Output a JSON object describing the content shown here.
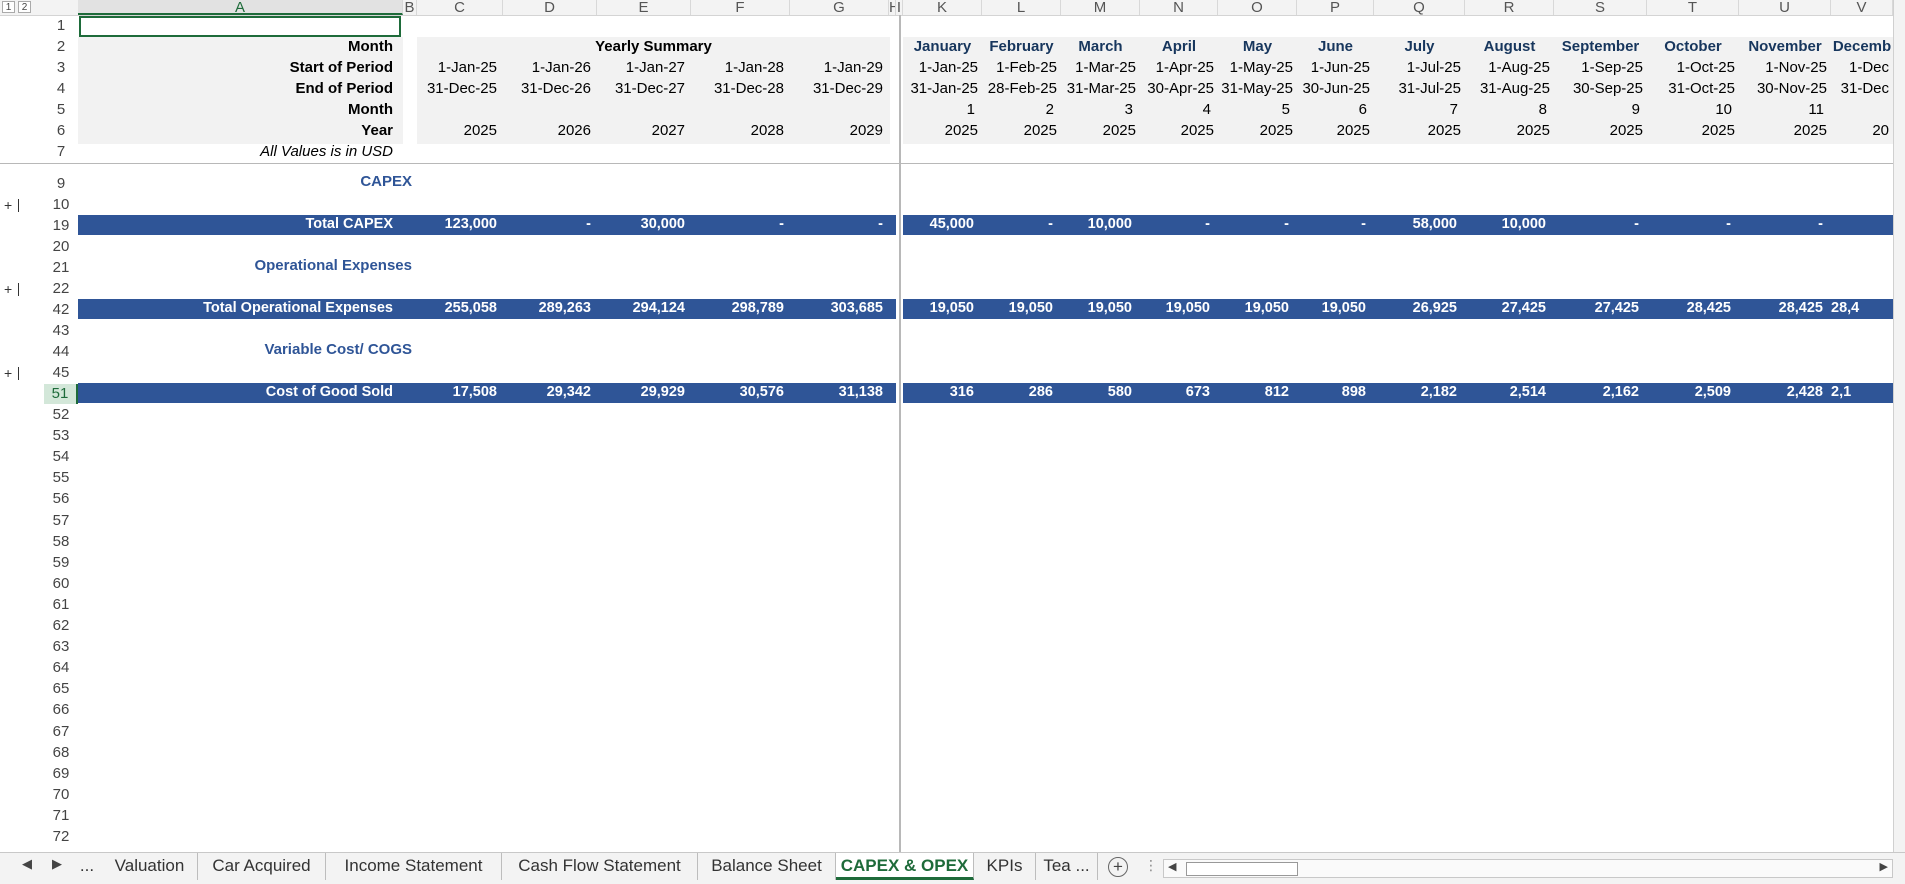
{
  "outline_levels": [
    "1",
    "2"
  ],
  "columns": [
    "A",
    "B",
    "C",
    "D",
    "E",
    "F",
    "G",
    "H",
    "I",
    "K",
    "L",
    "M",
    "N",
    "O",
    "P",
    "Q",
    "R",
    "S",
    "T",
    "U",
    "V"
  ],
  "header_rows": {
    "labels": [
      "Month",
      "Start of Period",
      "End of Period",
      "Month",
      "Year",
      "All Values is in USD"
    ],
    "yearly_summary_title": "Yearly Summary",
    "yearly": [
      {
        "start": "1-Jan-25",
        "end": "31-Dec-25",
        "year": "2025"
      },
      {
        "start": "1-Jan-26",
        "end": "31-Dec-26",
        "year": "2026"
      },
      {
        "start": "1-Jan-27",
        "end": "31-Dec-27",
        "year": "2027"
      },
      {
        "start": "1-Jan-28",
        "end": "31-Dec-28",
        "year": "2028"
      },
      {
        "start": "1-Jan-29",
        "end": "31-Dec-29",
        "year": "2029"
      }
    ],
    "monthly": [
      {
        "name": "January",
        "start": "1-Jan-25",
        "end": "31-Jan-25",
        "num": "1",
        "year": "2025"
      },
      {
        "name": "February",
        "start": "1-Feb-25",
        "end": "28-Feb-25",
        "num": "2",
        "year": "2025"
      },
      {
        "name": "March",
        "start": "1-Mar-25",
        "end": "31-Mar-25",
        "num": "3",
        "year": "2025"
      },
      {
        "name": "April",
        "start": "1-Apr-25",
        "end": "30-Apr-25",
        "num": "4",
        "year": "2025"
      },
      {
        "name": "May",
        "start": "1-May-25",
        "end": "31-May-25",
        "num": "5",
        "year": "2025"
      },
      {
        "name": "June",
        "start": "1-Jun-25",
        "end": "30-Jun-25",
        "num": "6",
        "year": "2025"
      },
      {
        "name": "July",
        "start": "1-Jul-25",
        "end": "31-Jul-25",
        "num": "7",
        "year": "2025"
      },
      {
        "name": "August",
        "start": "1-Aug-25",
        "end": "31-Aug-25",
        "num": "8",
        "year": "2025"
      },
      {
        "name": "September",
        "start": "1-Sep-25",
        "end": "30-Sep-25",
        "num": "9",
        "year": "2025"
      },
      {
        "name": "October",
        "start": "1-Oct-25",
        "end": "31-Oct-25",
        "num": "10",
        "year": "2025"
      },
      {
        "name": "November",
        "start": "1-Nov-25",
        "end": "30-Nov-25",
        "num": "11",
        "year": "2025"
      },
      {
        "name": "Decemb",
        "start": "1-Dec",
        "end": "31-Dec",
        "num": "",
        "year": "20"
      }
    ]
  },
  "sections": {
    "capex_title": "CAPEX",
    "opex_title": "Operational Expenses",
    "cogs_title": "Variable Cost/ COGS"
  },
  "totals": [
    {
      "label": "Total CAPEX",
      "yearly": [
        "123,000",
        "-",
        "30,000",
        "-",
        "-"
      ],
      "monthly": [
        "45,000",
        "-",
        "10,000",
        "-",
        "-",
        "-",
        "58,000",
        "10,000",
        "-",
        "-",
        "-",
        ""
      ]
    },
    {
      "label": "Total Operational Expenses",
      "yearly": [
        "255,058",
        "289,263",
        "294,124",
        "298,789",
        "303,685"
      ],
      "monthly": [
        "19,050",
        "19,050",
        "19,050",
        "19,050",
        "19,050",
        "19,050",
        "26,925",
        "27,425",
        "27,425",
        "28,425",
        "28,425",
        "28,4"
      ]
    },
    {
      "label": "Cost of Good Sold",
      "yearly": [
        "17,508",
        "29,342",
        "29,929",
        "30,576",
        "31,138"
      ],
      "monthly": [
        "316",
        "286",
        "580",
        "673",
        "812",
        "898",
        "2,182",
        "2,514",
        "2,162",
        "2,509",
        "2,428",
        "2,1"
      ]
    }
  ],
  "row_numbers": [
    "1",
    "2",
    "3",
    "4",
    "5",
    "6",
    "7",
    "9",
    "10",
    "19",
    "20",
    "21",
    "22",
    "42",
    "43",
    "44",
    "45",
    "51",
    "52",
    "53",
    "54",
    "55",
    "56",
    "57",
    "58",
    "59",
    "60",
    "61",
    "62",
    "63",
    "64",
    "65",
    "66",
    "67",
    "68",
    "69",
    "70",
    "71",
    "72"
  ],
  "selected_row": "51",
  "tabs": [
    "...",
    "Valuation",
    "Car Acquired",
    "Income Statement",
    "Cash Flow Statement",
    "Balance Sheet",
    "CAPEX & OPEX",
    "KPIs",
    "Tea ..."
  ],
  "active_tab": "CAPEX & OPEX",
  "colors": {
    "bar": "#2f5597",
    "header_band": "#f2f2f2",
    "accent": "#1e6b3a"
  }
}
